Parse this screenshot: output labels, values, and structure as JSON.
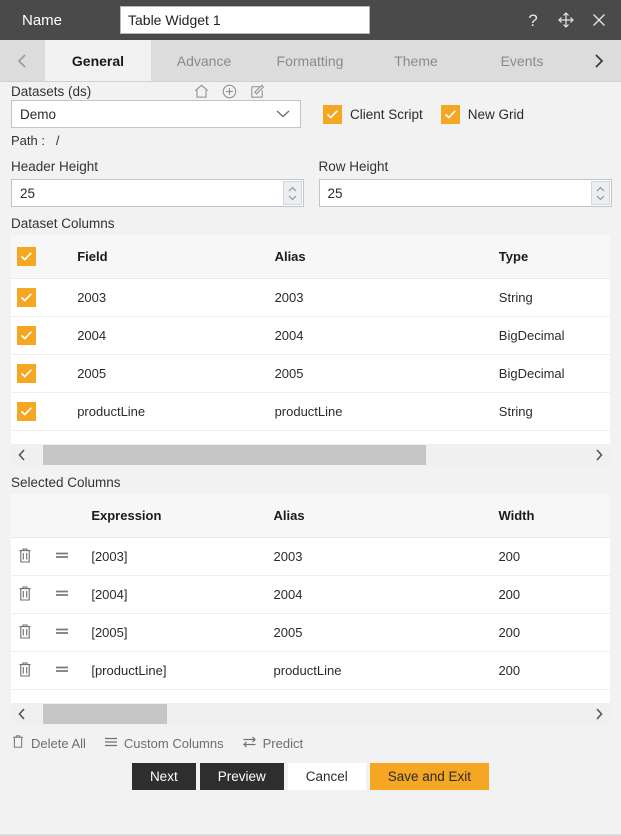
{
  "titlebar": {
    "name_label": "Name",
    "widget_name": "Table Widget 1",
    "widget_name_placeholder": "Name",
    "icons": {
      "help": "help-icon",
      "move": "move-icon",
      "close": "close-icon"
    }
  },
  "tabs": {
    "prev_arrow": "chevron-left-icon",
    "next_arrow": "chevron-right-icon",
    "items": [
      {
        "label": "General",
        "active": true
      },
      {
        "label": "Advance",
        "active": false
      },
      {
        "label": "Formatting",
        "active": false
      },
      {
        "label": "Theme",
        "active": false
      },
      {
        "label": "Events",
        "active": false
      }
    ]
  },
  "datasets": {
    "title": "Datasets (ds)",
    "icons": [
      "home-icon",
      "plus-circle-icon",
      "edit-icon"
    ],
    "selected": "Demo",
    "path_label": "Path :",
    "path_value": "/",
    "client_script": {
      "label": "Client Script",
      "checked": true
    },
    "new_grid": {
      "label": "New Grid",
      "checked": true
    }
  },
  "heights": {
    "header_height_label": "Header Height",
    "header_height_value": "25",
    "row_height_label": "Row Height",
    "row_height_value": "25"
  },
  "dataset_columns": {
    "section_title": "Dataset Columns",
    "headers": {
      "check": "",
      "field": "Field",
      "alias": "Alias",
      "type": "Type"
    },
    "header_checked": true,
    "rows": [
      {
        "checked": true,
        "field": "2003",
        "alias": "2003",
        "type": "String"
      },
      {
        "checked": true,
        "field": "2004",
        "alias": "2004",
        "type": "BigDecimal"
      },
      {
        "checked": true,
        "field": "2005",
        "alias": "2005",
        "type": "BigDecimal"
      },
      {
        "checked": true,
        "field": "productLine",
        "alias": "productLine",
        "type": "String"
      }
    ]
  },
  "selected_columns": {
    "section_title": "Selected Columns",
    "headers": {
      "expression": "Expression",
      "alias": "Alias",
      "width": "Width"
    },
    "rows": [
      {
        "expression": "[2003]",
        "alias": "2003",
        "width": "200"
      },
      {
        "expression": "[2004]",
        "alias": "2004",
        "width": "200"
      },
      {
        "expression": "[2005]",
        "alias": "2005",
        "width": "200"
      },
      {
        "expression": "[productLine]",
        "alias": "productLine",
        "width": "200"
      }
    ]
  },
  "tools": [
    {
      "label": "Delete All",
      "icon": "trash-icon"
    },
    {
      "label": "Custom Columns",
      "icon": "hamburger-icon"
    },
    {
      "label": "Predict",
      "icon": "swap-arrows-icon"
    }
  ],
  "buttons": [
    {
      "label": "Next",
      "style": "dark"
    },
    {
      "label": "Preview",
      "style": "dark"
    },
    {
      "label": "Cancel",
      "style": "light"
    },
    {
      "label": "Save and Exit",
      "style": "accent"
    }
  ],
  "colors": {
    "titlebar_bg": "#4a4a4a",
    "tabbar_bg": "#dcdcdc",
    "accent": "#f5a623",
    "content_bg": "#f2f2f2",
    "button_dark": "#2e2e2e"
  }
}
